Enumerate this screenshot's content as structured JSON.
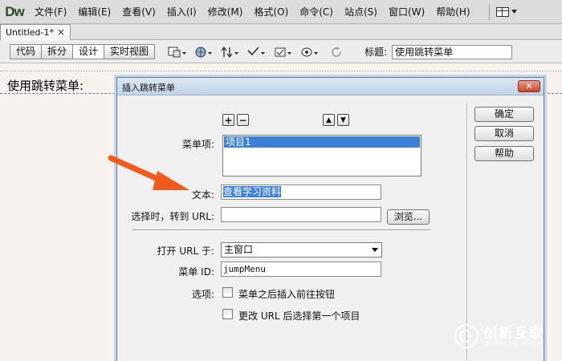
{
  "app": {
    "logo": "Dw",
    "menu": [
      "文件(F)",
      "编辑(E)",
      "查看(V)",
      "插入(I)",
      "修改(M)",
      "格式(O)",
      "命令(C)",
      "站点(S)",
      "窗口(W)",
      "帮助(H)"
    ]
  },
  "tab": {
    "title": "Untitled-1*",
    "close": "×"
  },
  "toolbar": {
    "views": [
      "代码",
      "拆分",
      "设计",
      "实时视图"
    ],
    "active_view": "设计",
    "title_label": "标题:",
    "title_value": "使用跳转菜单"
  },
  "document": {
    "text": "使用跳转菜单:"
  },
  "dialog": {
    "title": "插入跳转菜单",
    "close": "✕",
    "buttons": {
      "ok": "确定",
      "cancel": "取消",
      "help": "帮助"
    },
    "list_controls": {
      "add": "+",
      "remove": "−",
      "up": "▲",
      "down": "▼"
    },
    "menu_items_label": "菜单项:",
    "menu_items": [
      "项目1"
    ],
    "text_label": "文本:",
    "text_value": "查看学习资料",
    "url_label": "选择时，转到 URL:",
    "url_value": "",
    "browse": "浏览...",
    "open_in_label": "打开 URL 于:",
    "open_in_value": "主窗口",
    "menu_id_label": "菜单 ID:",
    "menu_id_value": "jumpMenu",
    "options_label": "选项:",
    "option1": "菜单之后插入前往按钮",
    "option2": "更改 URL 后选择第一个项目",
    "option1_checked": false,
    "option2_checked": false
  },
  "watermark": {
    "name": "创新互联",
    "sub": "CHUANG XIN HU LIAN"
  },
  "colors": {
    "annotation_arrow": "#f05a1c",
    "selection": "#3d80d8"
  }
}
